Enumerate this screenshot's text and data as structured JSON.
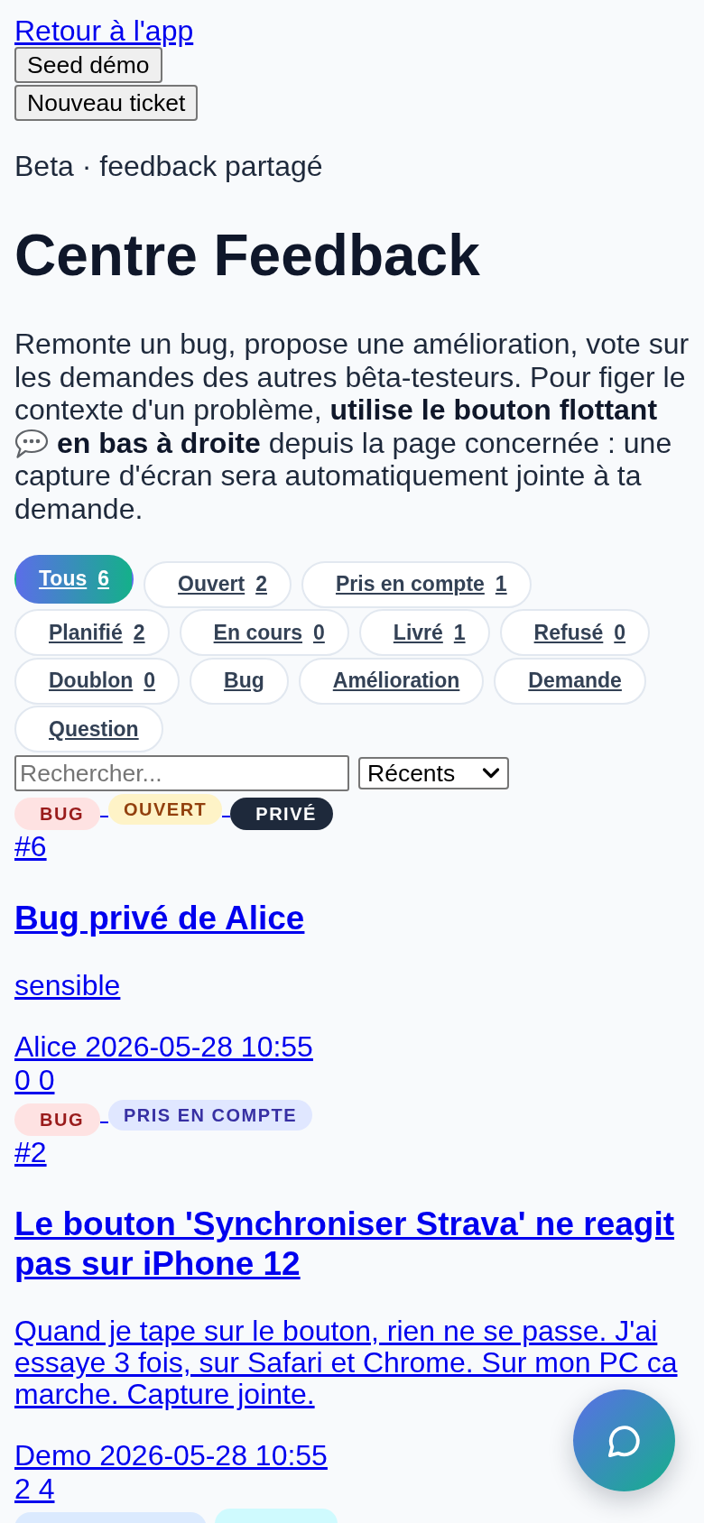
{
  "header": {
    "back_link": "Retour à l'app",
    "buttons": [
      {
        "label": "Seed démo"
      },
      {
        "label": "Nouveau ticket"
      }
    ]
  },
  "eyebrow": "Beta · feedback partagé",
  "title": "Centre Feedback",
  "intro": {
    "before": "Remonte un bug, propose une amélioration, vote sur les demandes des autres bêta-testeurs. Pour figer le contexte d'un problème, **utilise le bouton flottant**",
    "after": "**en bas à droite** depuis la page concernée : une capture d'écran sera automatiquement jointe à ta demande."
  },
  "filters": [
    {
      "label": "Tous",
      "count": "6",
      "selected": true
    },
    {
      "label": "Ouvert",
      "count": "2",
      "selected": false
    },
    {
      "label": "Pris en compte",
      "count": "1",
      "selected": false
    },
    {
      "label": "Planifié",
      "count": "2",
      "selected": false
    },
    {
      "label": "En cours",
      "count": "0",
      "selected": false
    },
    {
      "label": "Livré",
      "count": "1",
      "selected": false
    },
    {
      "label": "Refusé",
      "count": "0",
      "selected": false
    },
    {
      "label": "Doublon",
      "count": "0",
      "selected": false
    },
    {
      "label": "Bug",
      "selected": false
    },
    {
      "label": "Amélioration",
      "selected": false
    },
    {
      "label": "Demande",
      "selected": false
    },
    {
      "label": "Question",
      "selected": false
    }
  ],
  "search": {
    "placeholder": "Rechercher..."
  },
  "sort": {
    "value": "Récents"
  },
  "tickets": [
    {
      "badges": [
        {
          "label": "BUG",
          "kind": "type",
          "color": "#fee2e2",
          "foreground": {
            "color": "#991b1b"
          }
        },
        {
          "label": "OUVERT",
          "kind": "status",
          "color": "#fef3c7",
          "foreground": {
            "color": "#92400e"
          }
        },
        {
          "label": "PRIVÉ",
          "kind": "visibility",
          "color": "#1e293b"
        }
      ],
      "number": "#6",
      "title": "Bug privé de Alice",
      "body": "sensible",
      "meta": "Alice 2026-05-28 10:55",
      "stats": "0 0"
    },
    {
      "badges": [
        {
          "label": "BUG",
          "kind": "type",
          "color": "#fee2e2",
          "foreground": {
            "color": "#991b1b"
          }
        },
        {
          "label": "PRIS EN COMPTE",
          "kind": "status",
          "color": "#e0e7ff",
          "foreground": {
            "color": "#3730a3"
          }
        }
      ],
      "number": "#2",
      "title": "Le bouton 'Synchroniser Strava' ne reagit pas sur iPhone 12",
      "body": "Quand je tape sur le bouton, rien ne se passe. J'ai essaye 3 fois, sur Safari et Chrome. Sur mon PC ca marche. Capture jointe.",
      "meta": "Demo 2026-05-28 10:55",
      "stats": "2 4"
    },
    {
      "badges": [
        {
          "kind": "type",
          "color": "#dbeafe"
        },
        {
          "kind": "status",
          "color": "#cffafe"
        }
      ]
    }
  ]
}
